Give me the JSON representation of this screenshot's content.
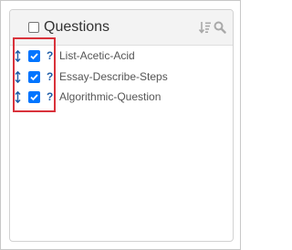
{
  "panel": {
    "title": "Questions",
    "header_checkbox_checked": false,
    "icons": [
      "sort-ascending-icon",
      "search-icon"
    ]
  },
  "rows": [
    {
      "label": "List-Acetic-Acid",
      "checked": true,
      "help": "?"
    },
    {
      "label": "Essay-Describe-Steps",
      "checked": true,
      "help": "?"
    },
    {
      "label": "Algorithmic-Question",
      "checked": true,
      "help": "?"
    }
  ],
  "colors": {
    "accent_blue": "#0075ff",
    "help_icon": "#1f5da8",
    "highlight_border": "#d9323b",
    "header_bg": "#f3f3f3"
  }
}
